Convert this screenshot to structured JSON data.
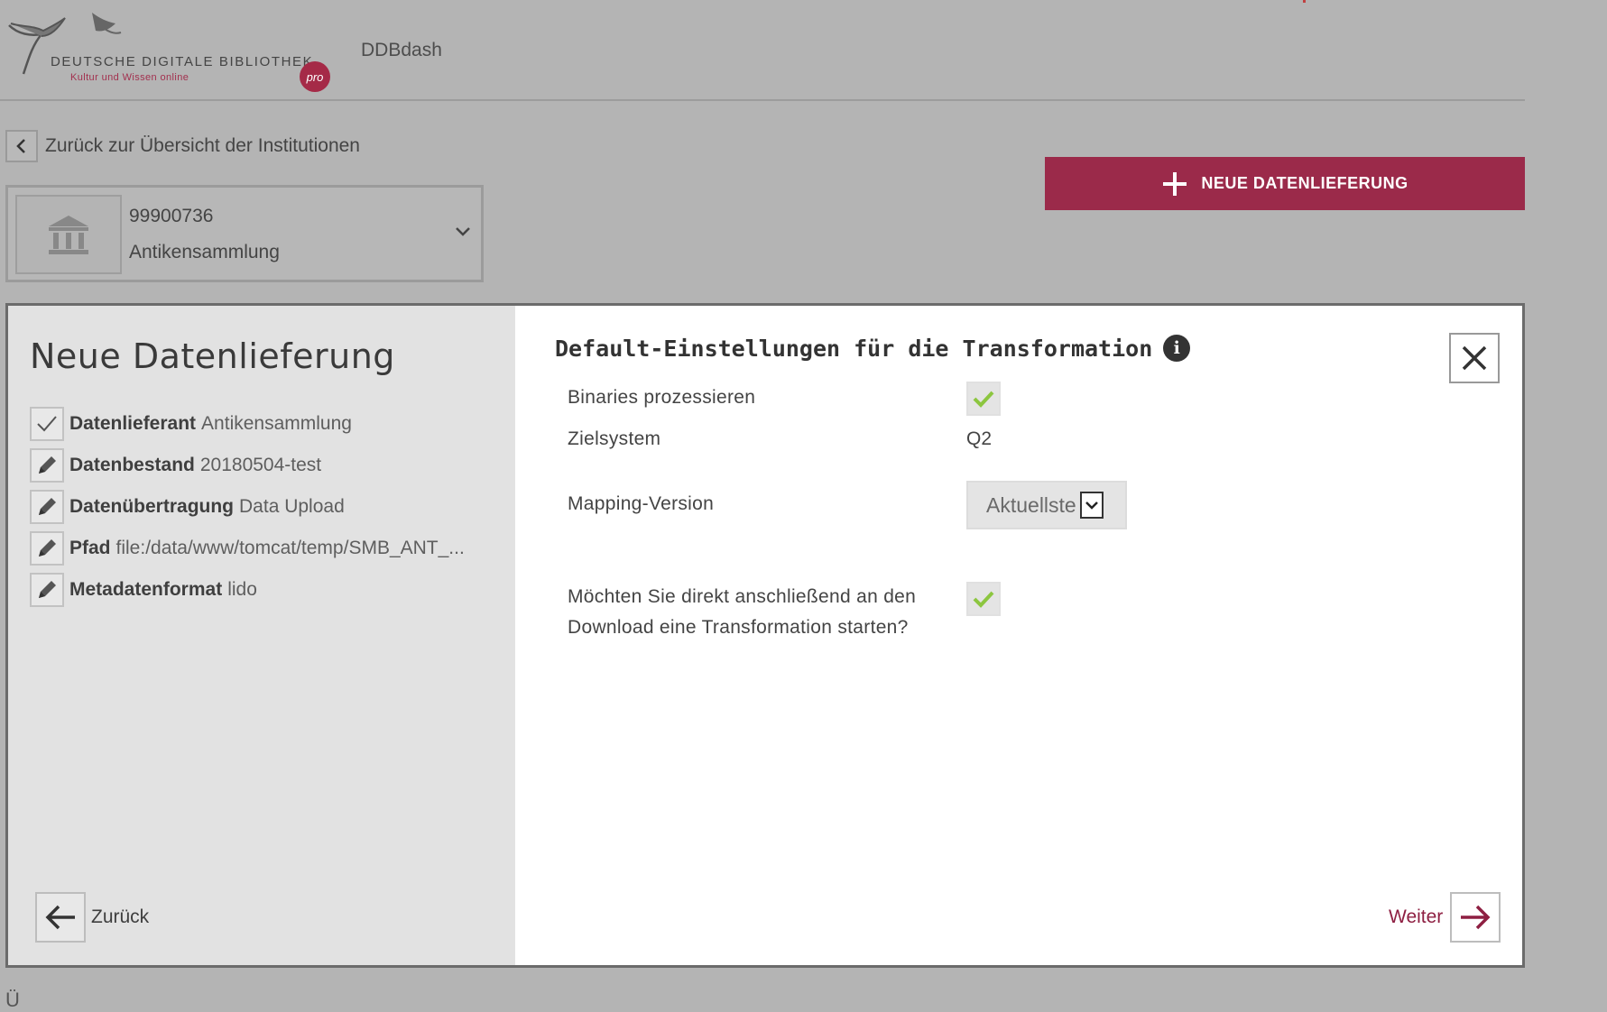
{
  "header": {
    "logo_name": "DEUTSCHE DIGITALE BIBLIOTHEK",
    "logo_sub": "Kultur und Wissen online",
    "logo_badge": "pro",
    "app_name": "DDBdash"
  },
  "nav": {
    "back_label": "Zurück zur Übersicht der Institutionen"
  },
  "institution": {
    "id": "99900736",
    "name": "Antikensammlung"
  },
  "actions": {
    "new_delivery_label": "NEUE DATENLIEFERUNG"
  },
  "dialog": {
    "title": "Neue Datenlieferung",
    "steps": [
      {
        "label": "Datenlieferant",
        "value": "Antikensammlung",
        "icon": "check-icon"
      },
      {
        "label": "Datenbestand",
        "value": "20180504-test",
        "icon": "pencil-icon"
      },
      {
        "label": "Datenübertragung",
        "value": "Data Upload",
        "icon": "pencil-icon"
      },
      {
        "label": "Pfad",
        "value": "file:/data/www/tomcat/temp/SMB_ANT_...",
        "icon": "pencil-icon"
      },
      {
        "label": "Metadatenformat",
        "value": "lido",
        "icon": "pencil-icon"
      }
    ],
    "back_label": "Zurück",
    "section_title": "Default-Einstellungen für die Transformation",
    "fields": {
      "binaries_label": "Binaries prozessieren",
      "binaries_checked": true,
      "zielsystem_label": "Zielsystem",
      "zielsystem_value": "Q2",
      "mapping_label": "Mapping-Version",
      "mapping_value": "Aktuellste",
      "transform_label_line1": "Möchten Sie direkt anschließend an den",
      "transform_label_line2": "Download eine Transformation starten?",
      "transform_checked": true
    },
    "next_label": "Weiter"
  },
  "colors": {
    "accent": "#9b2a4a",
    "check_green": "#8cc63f",
    "overlay_gray": "#b4b4b4"
  }
}
